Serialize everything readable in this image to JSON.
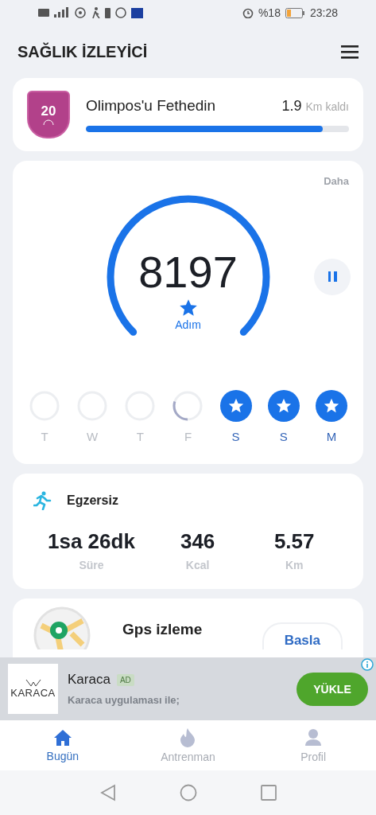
{
  "status_bar": {
    "battery": "%18",
    "time": "23:28"
  },
  "header": {
    "title": "SAĞLIK İZLEYİCİ"
  },
  "challenge": {
    "badge": "20",
    "title": "Olimpos'u Fethedin",
    "remaining": "1.9",
    "unit": "Km kaldı",
    "level": 0.9
  },
  "steps": {
    "more": "Daha",
    "count": "8197",
    "label": "Adım",
    "paused": false,
    "days": [
      {
        "label": "T",
        "kind": "empty"
      },
      {
        "label": "W",
        "kind": "empty"
      },
      {
        "label": "T",
        "kind": "empty"
      },
      {
        "label": "F",
        "kind": "partial"
      },
      {
        "label": "S",
        "kind": "goal"
      },
      {
        "label": "S",
        "kind": "goal"
      },
      {
        "label": "M",
        "kind": "goal"
      }
    ]
  },
  "exercise": {
    "title": "Egzersiz",
    "stats": [
      {
        "value": "1sa 26dk",
        "label": "Süre"
      },
      {
        "value": "346",
        "label": "Kcal"
      },
      {
        "value": "5.57",
        "label": "Km"
      }
    ]
  },
  "gps": {
    "title": "Gps izleme",
    "button": "Basla"
  },
  "ad": {
    "logo": "KARACA",
    "title": "Karaca",
    "badge": "AD",
    "text": "Karaca uygulaması ile;",
    "button": "YÜKLE"
  },
  "tabs": [
    {
      "label": "Bugün",
      "selected": true,
      "kind": "home"
    },
    {
      "label": "Antrenman",
      "selected": false,
      "kind": "fire"
    },
    {
      "label": "Profil",
      "selected": false,
      "kind": "person"
    }
  ]
}
